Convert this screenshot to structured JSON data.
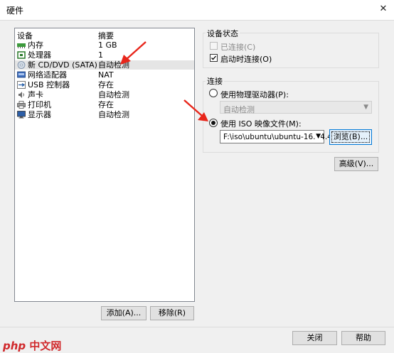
{
  "window": {
    "title": "硬件"
  },
  "device_list": {
    "headers": {
      "device": "设备",
      "summary": "摘要"
    },
    "rows": [
      {
        "name": "内存",
        "summary": "1 GB",
        "icon": "memory-icon"
      },
      {
        "name": "处理器",
        "summary": "1",
        "icon": "cpu-icon"
      },
      {
        "name": "新 CD/DVD (SATA)",
        "summary": "自动检测",
        "icon": "cd-dvd-icon"
      },
      {
        "name": "网络适配器",
        "summary": "NAT",
        "icon": "network-icon"
      },
      {
        "name": "USB 控制器",
        "summary": "存在",
        "icon": "usb-icon"
      },
      {
        "name": "声卡",
        "summary": "自动检测",
        "icon": "sound-icon"
      },
      {
        "name": "打印机",
        "summary": "存在",
        "icon": "printer-icon"
      },
      {
        "name": "显示器",
        "summary": "自动检测",
        "icon": "display-icon"
      }
    ],
    "selected_index": 2
  },
  "buttons": {
    "add": "添加(A)...",
    "remove": "移除(R)",
    "advanced": "高级(V)...",
    "close": "关闭",
    "help": "帮助",
    "browse": "浏览(B)..."
  },
  "device_status": {
    "label": "设备状态",
    "connected": {
      "label": "已连接(C)",
      "checked": false,
      "enabled": false
    },
    "connect_at_power_on": {
      "label": "启动时连接(O)",
      "checked": true
    }
  },
  "connection": {
    "label": "连接",
    "use_physical_drive": {
      "label": "使用物理驱动器(P):",
      "selected": false
    },
    "physical_drive_value": "自动检测",
    "use_iso": {
      "label": "使用 ISO 映像文件(M):",
      "selected": true
    },
    "iso_path": "F:\\iso\\ubuntu\\ubuntu-16.04.4-"
  },
  "watermark": {
    "text": "php",
    "zh": "中文网"
  },
  "colors": {
    "arrow": "#e8261b",
    "selection": "#e5e5e5",
    "focus_border": "#0078d7"
  }
}
